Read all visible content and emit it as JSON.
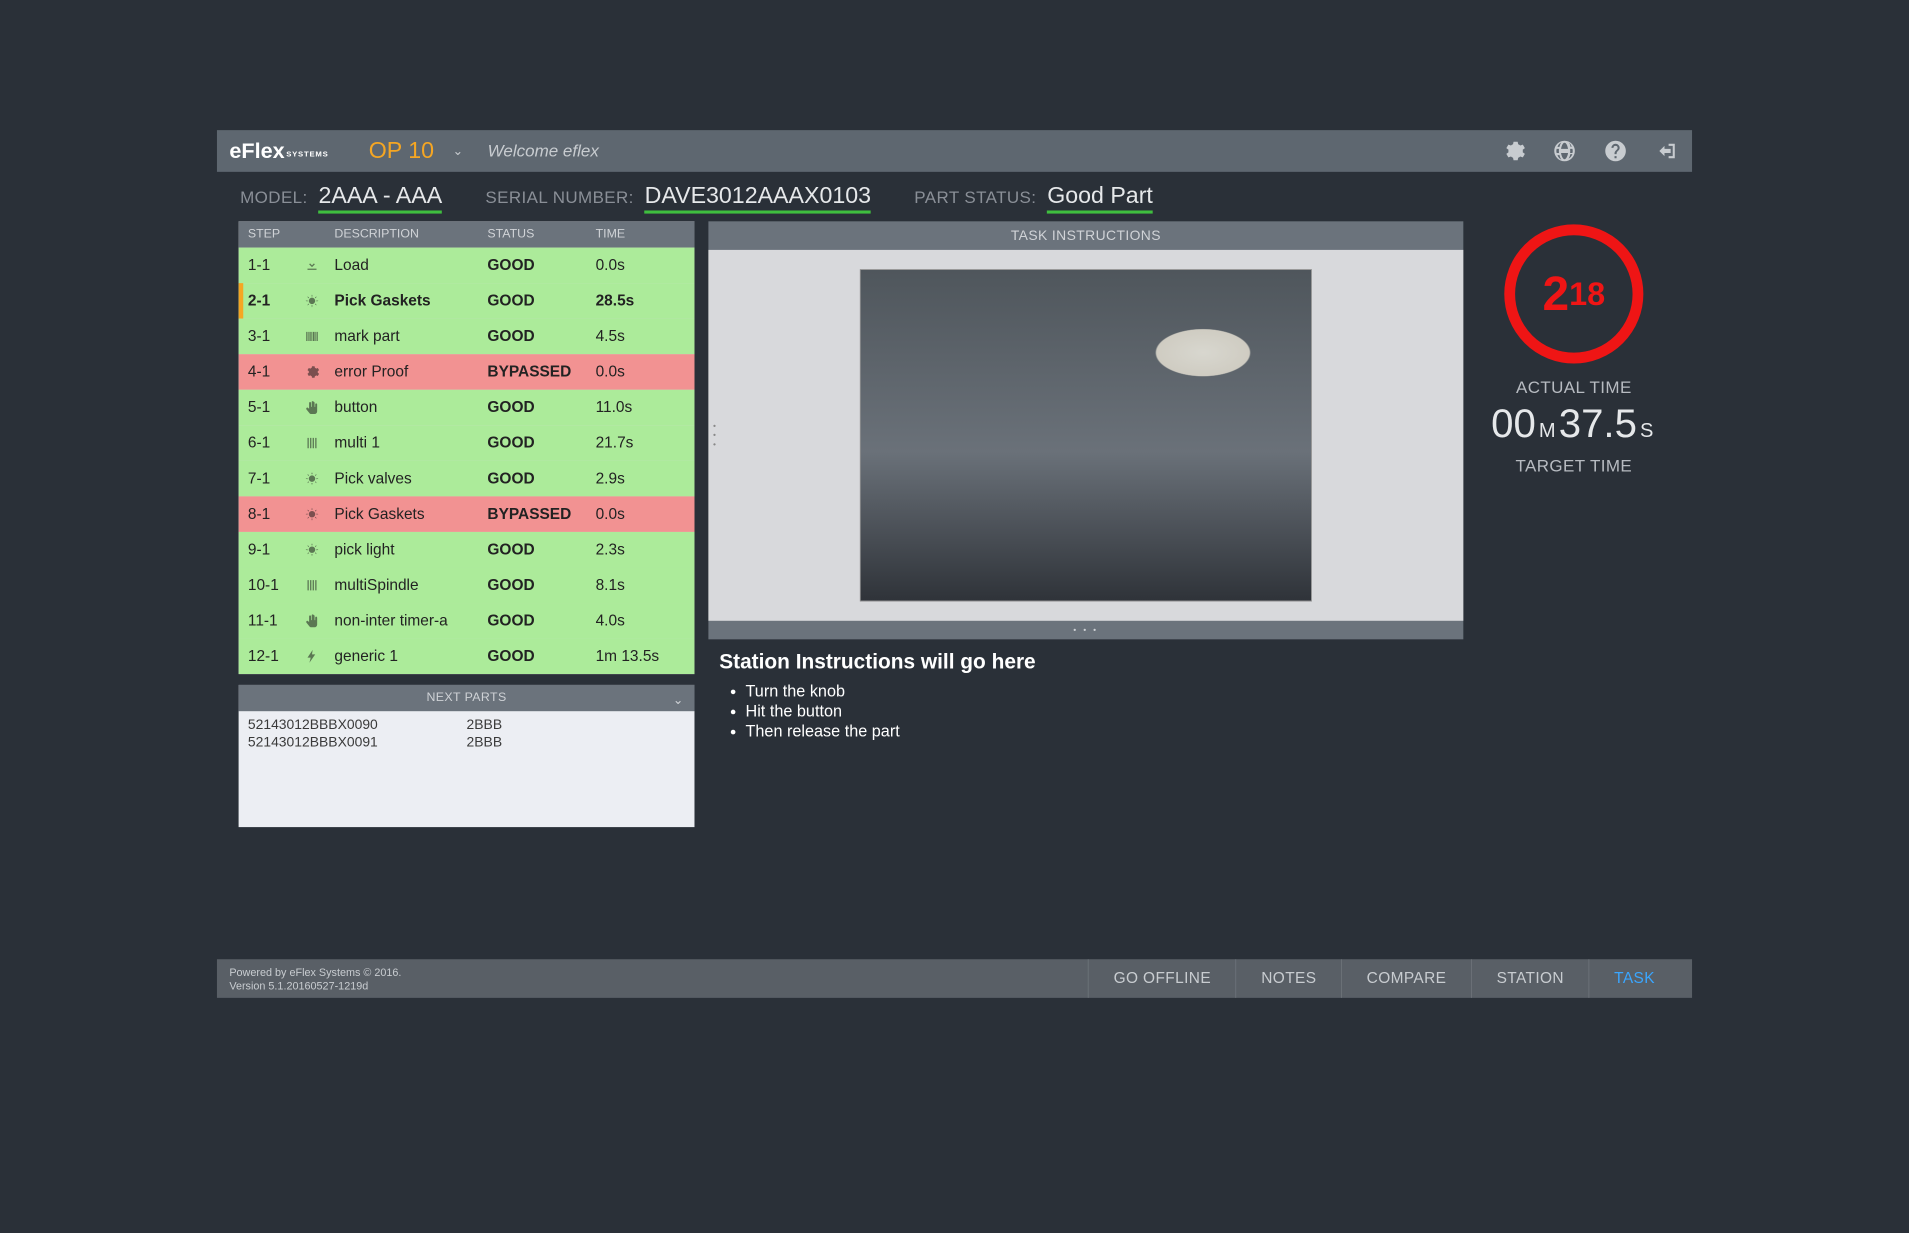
{
  "header": {
    "brand_e": "e",
    "brand_flex": "Flex",
    "brand_sys": "SYSTEMS",
    "op": "OP 10",
    "welcome": "Welcome eflex"
  },
  "info": {
    "model_label": "MODEL:",
    "model_value": "2AAA - AAA",
    "serial_label": "SERIAL NUMBER:",
    "serial_value": "DAVE3012AAAX0103",
    "status_label": "PART STATUS:",
    "status_value": "Good Part"
  },
  "steps": {
    "headers": {
      "step": "STEP",
      "desc": "DESCRIPTION",
      "status": "STATUS",
      "time": "TIME"
    },
    "rows": [
      {
        "step": "1-1",
        "icon": "download",
        "desc": "Load",
        "status": "GOOD",
        "time": "0.0s",
        "cls": "good"
      },
      {
        "step": "2-1",
        "icon": "sun",
        "desc": "Pick Gaskets",
        "status": "GOOD",
        "time": "28.5s",
        "cls": "good",
        "hl": true
      },
      {
        "step": "3-1",
        "icon": "barcode",
        "desc": "mark part",
        "status": "GOOD",
        "time": "4.5s",
        "cls": "good"
      },
      {
        "step": "4-1",
        "icon": "gear",
        "desc": "error Proof",
        "status": "BYPASSED",
        "time": "0.0s",
        "cls": "bypassed"
      },
      {
        "step": "5-1",
        "icon": "hand",
        "desc": "button",
        "status": "GOOD",
        "time": "11.0s",
        "cls": "good"
      },
      {
        "step": "6-1",
        "icon": "bars",
        "desc": "multi 1",
        "status": "GOOD",
        "time": "21.7s",
        "cls": "good"
      },
      {
        "step": "7-1",
        "icon": "sun",
        "desc": "Pick valves",
        "status": "GOOD",
        "time": "2.9s",
        "cls": "good"
      },
      {
        "step": "8-1",
        "icon": "sun",
        "desc": "Pick Gaskets",
        "status": "BYPASSED",
        "time": "0.0s",
        "cls": "bypassed"
      },
      {
        "step": "9-1",
        "icon": "sun",
        "desc": "pick light",
        "status": "GOOD",
        "time": "2.3s",
        "cls": "good"
      },
      {
        "step": "10-1",
        "icon": "bars",
        "desc": "multiSpindle",
        "status": "GOOD",
        "time": "8.1s",
        "cls": "good"
      },
      {
        "step": "11-1",
        "icon": "hand",
        "desc": "non-inter timer-a",
        "status": "GOOD",
        "time": "4.0s",
        "cls": "good"
      },
      {
        "step": "12-1",
        "icon": "bolt",
        "desc": "generic 1",
        "status": "GOOD",
        "time": "1m 13.5s",
        "cls": "good"
      }
    ]
  },
  "nextparts": {
    "title": "NEXT PARTS",
    "rows": [
      {
        "serial": "52143012BBBX0090",
        "model": "2BBB"
      },
      {
        "serial": "52143012BBBX0091",
        "model": "2BBB"
      }
    ]
  },
  "task": {
    "title": "TASK INSTRUCTIONS",
    "station_heading": "Station Instructions will go here",
    "bullets": [
      "Turn the knob",
      "Hit the button",
      "Then release the part"
    ]
  },
  "timer": {
    "ring_big": "2",
    "ring_small": "18",
    "actual_label": "ACTUAL TIME",
    "actual_m": "00",
    "actual_mu": "M",
    "actual_s": "37.5",
    "actual_su": "S",
    "target_label": "TARGET TIME"
  },
  "footer": {
    "powered": "Powered by eFlex Systems © 2016.",
    "version": "Version 5.1.20160527-1219d",
    "buttons": [
      "GO OFFLINE",
      "NOTES",
      "COMPARE",
      "STATION",
      "TASK"
    ],
    "active": "TASK"
  }
}
